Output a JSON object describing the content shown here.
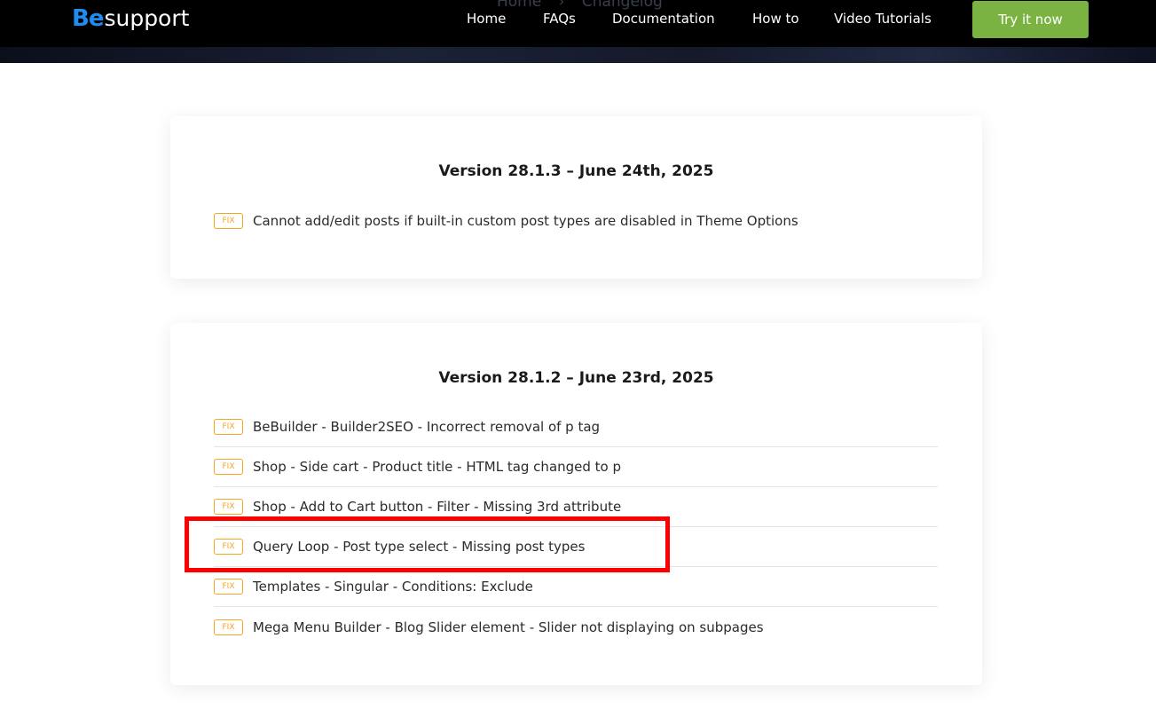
{
  "header": {
    "logo": {
      "be": "Be",
      "support": "support"
    },
    "breadcrumb": [
      "Home",
      "›",
      "Changelog"
    ],
    "nav": [
      "Home",
      "FAQs",
      "Documentation",
      "How to",
      "Video Tutorials"
    ],
    "cta": "Try it now"
  },
  "changelog": [
    {
      "version": "Version 28.1.3 – June 24th, 2025",
      "entries": [
        {
          "badge": "FIX",
          "text": "Cannot add/edit posts if built-in custom post types are disabled in Theme Options"
        }
      ]
    },
    {
      "version": "Version 28.1.2 – June 23rd, 2025",
      "entries": [
        {
          "badge": "FIX",
          "text": "BeBuilder - Builder2SEO - Incorrect removal of p tag"
        },
        {
          "badge": "FIX",
          "text": "Shop - Side cart - Product title - HTML tag changed to p"
        },
        {
          "badge": "FIX",
          "text": "Shop - Add to Cart button - Filter - Missing 3rd attribute"
        },
        {
          "badge": "FIX",
          "text": "Query Loop - Post type select - Missing post types"
        },
        {
          "badge": "FIX",
          "text": "Templates - Singular - Conditions: Exclude"
        },
        {
          "badge": "FIX",
          "text": "Mega Menu Builder - Blog Slider element - Slider not displaying on subpages"
        }
      ]
    }
  ],
  "colors": {
    "accent_blue": "#1d8df1",
    "cta_green": "#7ab342",
    "fix_orange": "#f5a623",
    "highlight_red": "#ff0000"
  }
}
